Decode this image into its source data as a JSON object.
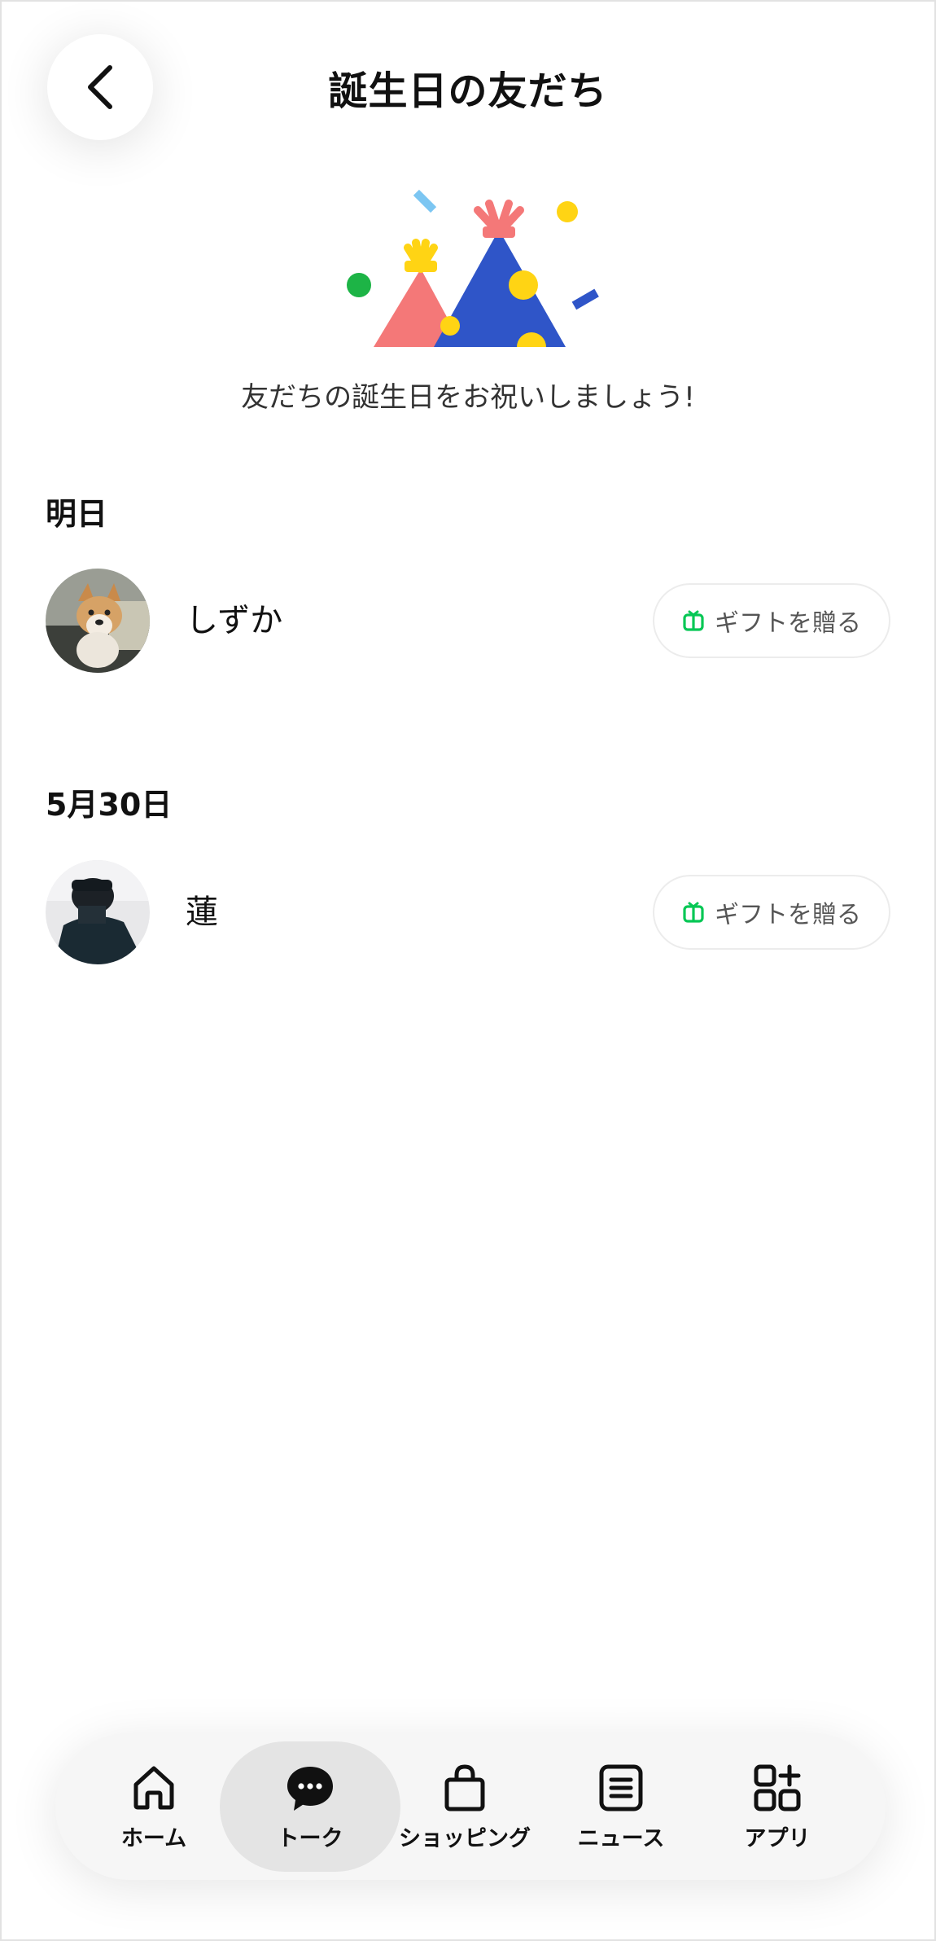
{
  "header": {
    "title": "誕生日の友だち",
    "back_icon": "chevron-left-icon"
  },
  "hero": {
    "subtitle": "友だちの誕生日をお祝いしましょう!",
    "colors": {
      "pink": "#F47878",
      "blue": "#2F55C8",
      "yellow": "#FFD414",
      "green": "#1DB446",
      "light_blue": "#7CC6F2"
    }
  },
  "sections": [
    {
      "heading": "明日",
      "friends": [
        {
          "name": "しずか",
          "gift_label": "ギフトを贈る",
          "avatar": "dog-photo"
        }
      ]
    },
    {
      "heading": "5月30日",
      "friends": [
        {
          "name": "蓮",
          "gift_label": "ギフトを贈る",
          "avatar": "person-photo"
        }
      ]
    }
  ],
  "gift_icon_color": "#06C755",
  "bottom_nav": {
    "items": [
      {
        "label": "ホーム",
        "icon": "home-icon",
        "active": false
      },
      {
        "label": "トーク",
        "icon": "chat-bubble-icon",
        "active": true
      },
      {
        "label": "ショッピング",
        "icon": "shopping-bag-icon",
        "active": false
      },
      {
        "label": "ニュース",
        "icon": "news-icon",
        "active": false
      },
      {
        "label": "アプリ",
        "icon": "apps-icon",
        "active": false
      }
    ]
  }
}
